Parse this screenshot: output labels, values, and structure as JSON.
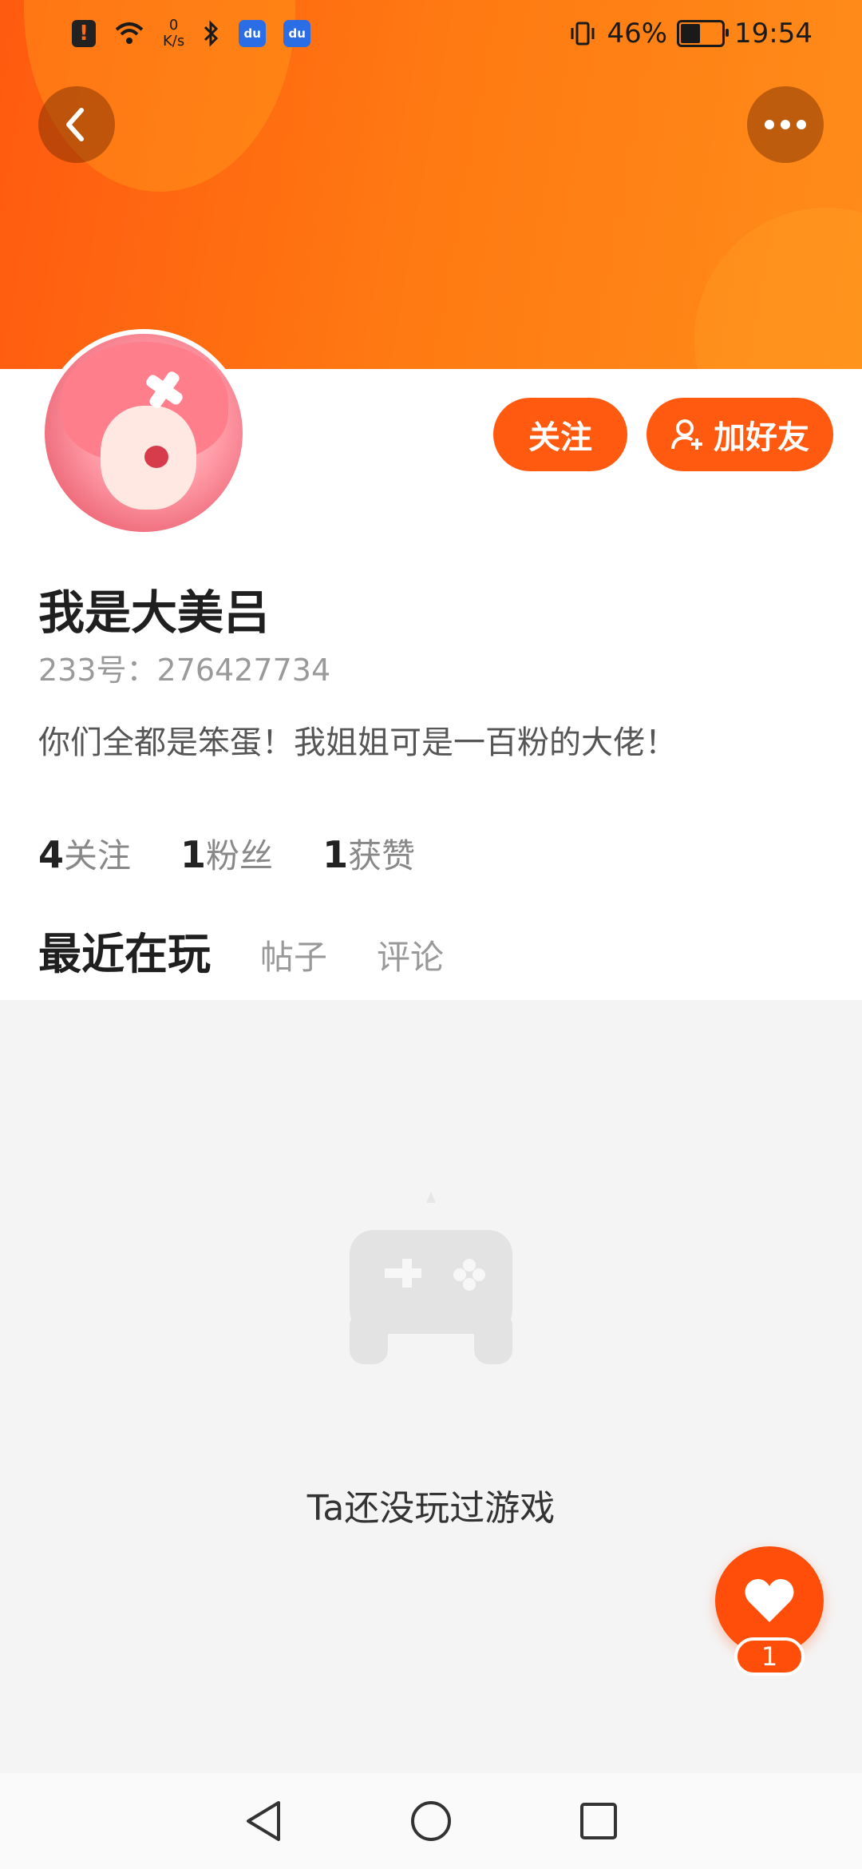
{
  "status_bar": {
    "net_speed_value": "0",
    "net_speed_unit": "K/s",
    "app_icon_text": "du",
    "battery_percent": "46%",
    "time": "19:54"
  },
  "profile": {
    "name": "我是大美吕",
    "uid": "233号：276427734",
    "bio": "你们全都是笨蛋！我姐姐可是一百粉的大佬！"
  },
  "actions": {
    "follow_label": "关注",
    "add_friend_label": "加好友"
  },
  "stats": [
    {
      "value": "4",
      "label": "关注"
    },
    {
      "value": "1",
      "label": "粉丝"
    },
    {
      "value": "1",
      "label": "获赞"
    }
  ],
  "tabs": [
    {
      "label": "最近在玩",
      "active": true
    },
    {
      "label": "帖子",
      "active": false
    },
    {
      "label": "评论",
      "active": false
    }
  ],
  "empty_state": {
    "text": "Ta还没玩过游戏"
  },
  "like_fab": {
    "count": "1"
  },
  "colors": {
    "accent": "#ff5a10",
    "content_bg": "#f4f4f4"
  },
  "icons": [
    "alert-icon",
    "wifi-icon",
    "bluetooth-icon",
    "vibrate-icon",
    "battery-icon",
    "back-icon",
    "more-icon",
    "add-friend-icon",
    "gamepad-icon",
    "heart-icon",
    "nav-back-icon",
    "nav-home-icon",
    "nav-recents-icon"
  ]
}
